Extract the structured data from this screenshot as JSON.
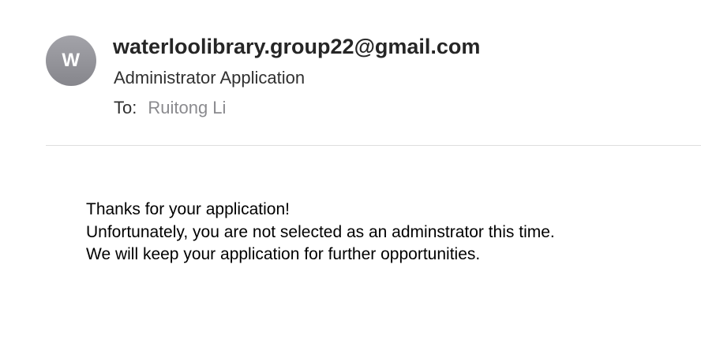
{
  "header": {
    "avatar_initial": "W",
    "sender": "waterloolibrary.group22@gmail.com",
    "subject": "Administrator Application",
    "to_label": "To:",
    "to_name": "Ruitong Li"
  },
  "body": {
    "lines": [
      "Thanks for your application!",
      "Unfortunately, you are not selected as an adminstrator this time.",
      "We will keep your application for further opportunities."
    ]
  },
  "colors": {
    "avatar": "#96969c",
    "sender_text": "#262626",
    "to_name_text": "#8a8a8e",
    "divider": "#dedede"
  }
}
